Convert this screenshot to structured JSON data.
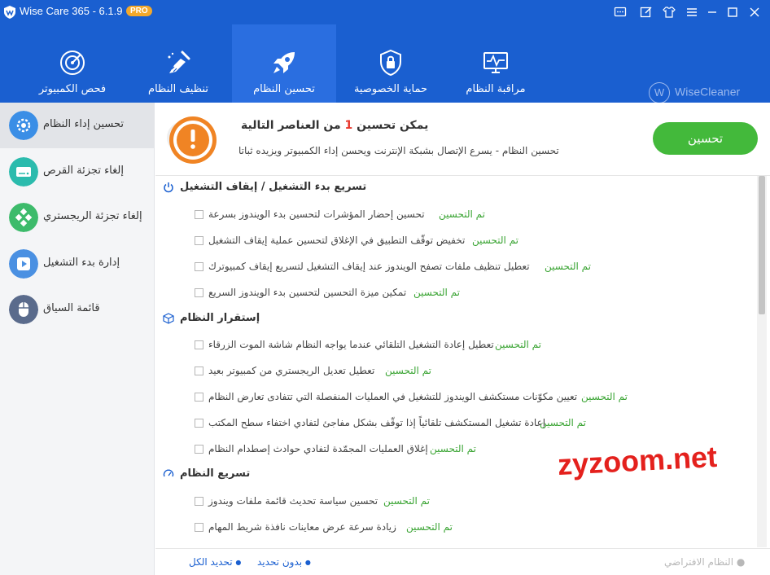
{
  "titlebar": {
    "title": "Wise Care 365 - 6.1.9",
    "badge": "PRO",
    "controls": [
      "chat-icon",
      "edit-icon",
      "skin-icon",
      "menu-icon",
      "minimize-icon",
      "maximize-icon",
      "close-icon"
    ]
  },
  "nav": {
    "items": [
      {
        "label": "فحص الكمبيوتر",
        "icon": "scan-target-icon"
      },
      {
        "label": "تنظيف النظام",
        "icon": "broom-icon"
      },
      {
        "label": "تحسين النظام",
        "icon": "rocket-icon"
      },
      {
        "label": "حماية الخصوصية",
        "icon": "shield-lock-icon"
      },
      {
        "label": "مراقبة النظام",
        "icon": "monitor-pulse-icon"
      }
    ],
    "active_index": 2,
    "brand": "WiseCleaner"
  },
  "sidebar": {
    "items": [
      {
        "label": "تحسين إداء النظام",
        "icon": "gear-icon",
        "color": "#3a8ee6"
      },
      {
        "label": "إلغاء تجزئة القرص",
        "icon": "disk-icon",
        "color": "#2bbbad"
      },
      {
        "label": "إلغاء تجزئة الريجستري",
        "icon": "registry-icon",
        "color": "#3dbb6b"
      },
      {
        "label": "إدارة بدء التشغيل",
        "icon": "startup-icon",
        "color": "#4a90e2"
      },
      {
        "label": "قائمة السياق",
        "icon": "mouse-icon",
        "color": "#5a6b8c"
      }
    ],
    "active_index": 0
  },
  "header": {
    "title_prefix": "يمكن تحسين",
    "count": "1",
    "title_suffix": "من العناصر التالية",
    "description": "تحسين النظام - يسرع الإتصال بشبكة الإنترنت ويحسن إداء الكمبيوتر ويزيده ثباتا",
    "optimize_button": "تحسين"
  },
  "sections": [
    {
      "title": "تسريع بدء التشغيل / إيقاف التشغيل",
      "icon": "power-icon",
      "items": [
        {
          "label": "تحسين إحضار المؤشرات لتحسين بدء الويندوز بسرعة",
          "status": "تم التحسين",
          "checked": false
        },
        {
          "label": "تخفيض توقّف التطبيق في الإغلاق لتحسين عملية إيقاف التشغيل",
          "status": "تم التحسين",
          "checked": false
        },
        {
          "label": "تعطيل تنظيف ملفات تصفح الويندوز عند إيقاف التشغيل لتسريع  إيقاف كمبيوترك",
          "status": "تم التحسين",
          "checked": false
        },
        {
          "label": "تمكين ميزة التحسين لتحسين بدء الويندوز السريع",
          "status": "تم التحسين",
          "checked": false
        }
      ]
    },
    {
      "title": "إستقرار النظام",
      "icon": "cube-icon",
      "items": [
        {
          "label": "تعطيل إعادة التشغيل التلقائي عندما يواجه النظام شاشة الموت الزرقاء",
          "status": "تم التحسين",
          "checked": false
        },
        {
          "label": "تعطيل تعديل الريجستري من كمبيوتر بعيد",
          "status": "تم التحسين",
          "checked": false
        },
        {
          "label": "تعيين مكوّنات مستكشف الويندوز للتشغيل في العمليات المنفصلة التي تتفادى تعارض النظام",
          "status": "تم التحسين",
          "checked": false
        },
        {
          "label": "إعادة تشغيل المستكشف تلقائياً إذا توقّف بشكل مفاجئ لتفادي اختفاء سطح المكتب",
          "status": "تم التحسين",
          "checked": false
        },
        {
          "label": "إغلاق العمليات المجمّدة لتفادي حوادث إصطدام النظام",
          "status": "تم التحسين",
          "checked": false
        }
      ]
    },
    {
      "title": "تسريع النظام",
      "icon": "speedometer-icon",
      "items": [
        {
          "label": "تحسين سياسة تحديث قائمة ملفات ويندوز",
          "status": "تم التحسين",
          "checked": false
        },
        {
          "label": "زيادة سرعة عرض معاينات نافذة شريط المهام",
          "status": "تم التحسين",
          "checked": false
        }
      ]
    }
  ],
  "footer": {
    "select_all": "تحديد الكل",
    "select_none": "بدون تحديد",
    "system_default": "النظام الافتراضي"
  },
  "watermark": "zyzoom.net",
  "colors": {
    "brand_blue": "#1a5fd0",
    "status_green": "#3aa433",
    "optimize_button": "#43b93b",
    "count_red": "#e8362b",
    "warning_orange": "#f08424"
  }
}
